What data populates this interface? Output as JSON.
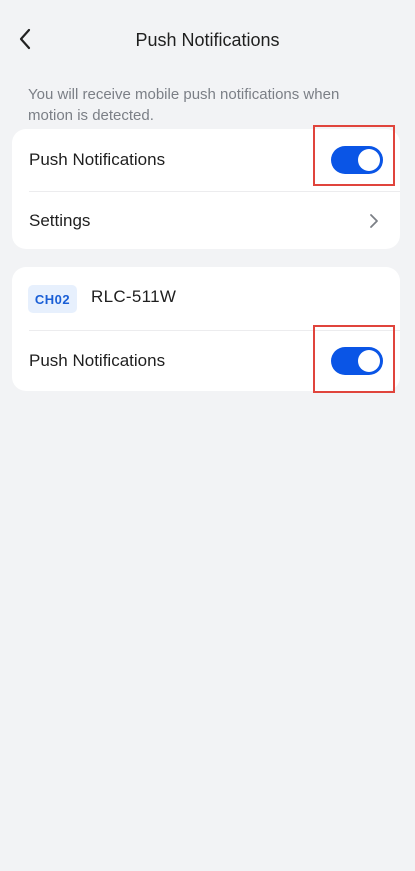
{
  "header": {
    "title": "Push Notifications"
  },
  "description": "You will receive mobile push notifications when motion is detected.",
  "main_card": {
    "push_label": "Push Notifications",
    "push_enabled": true,
    "settings_label": "Settings"
  },
  "device_card": {
    "channel": "CH02",
    "device_name": "RLC-511W",
    "push_label": "Push Notifications",
    "push_enabled": true
  },
  "colors": {
    "accent": "#0a55e6",
    "background": "#f2f3f5",
    "highlight_box": "#e0443c",
    "badge_bg": "#e7f0fd",
    "badge_text": "#1a5fd6"
  },
  "icons": {
    "back": "chevron-left-icon",
    "settings_arrow": "chevron-right-icon"
  }
}
